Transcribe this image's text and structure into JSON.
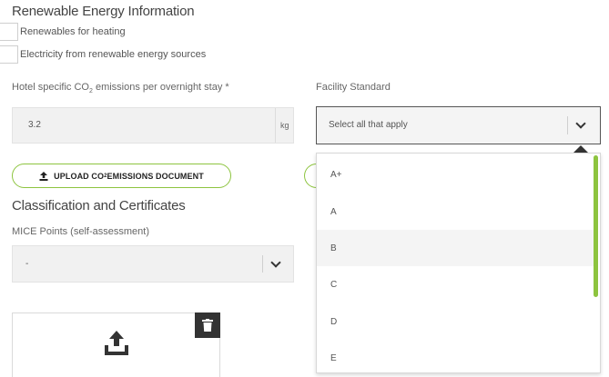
{
  "renewable": {
    "title": "Renewable Energy Information",
    "checkboxes": [
      {
        "label": "Renewables for heating",
        "checked": false
      },
      {
        "label": "Electricity from renewable energy sources",
        "checked": false
      }
    ]
  },
  "co2": {
    "label_prefix": "Hotel specific CO",
    "label_sub": "2",
    "label_suffix": " emissions per overnight stay *",
    "value": "3.2",
    "unit": "kg"
  },
  "facility": {
    "label": "Facility Standard",
    "placeholder": "Select all that apply",
    "options": [
      "A+",
      "A",
      "B",
      "C",
      "D",
      "E"
    ],
    "highlighted": "B"
  },
  "upload_co2": {
    "label_prefix": "UPLOAD CO",
    "label_sub": "2",
    "label_suffix": " EMISSIONS DOCUMENT"
  },
  "classification": {
    "title": "Classification and Certificates",
    "mice_label": "MICE Points (self-assessment)",
    "mice_value": "-"
  },
  "colors": {
    "accent": "#8dc43f",
    "dark": "#333333"
  }
}
